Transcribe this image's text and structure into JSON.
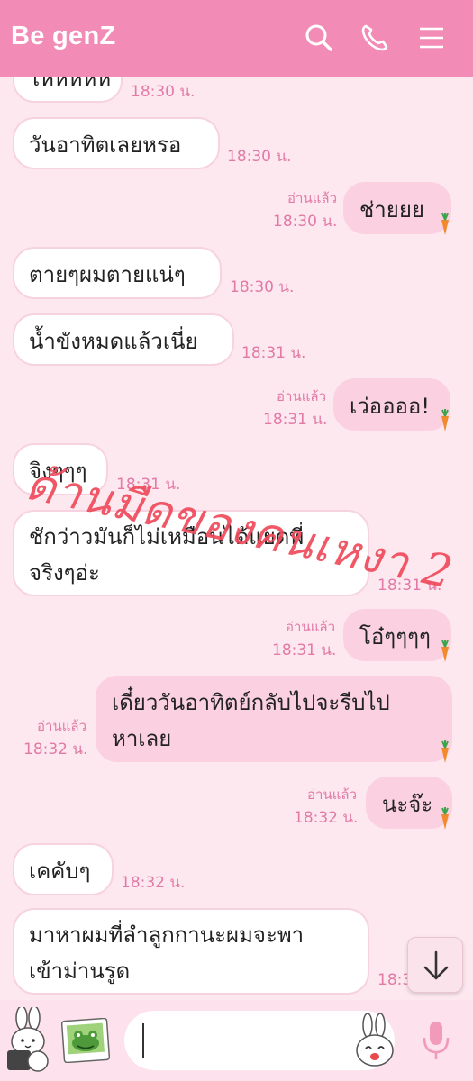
{
  "header": {
    "title": "Be genZ",
    "icons": [
      "search-icon",
      "phone-icon",
      "menu-icon"
    ]
  },
  "messages": [
    {
      "side": "in",
      "text": "ไหหหหห",
      "time": "18:30 น."
    },
    {
      "side": "in",
      "text": "วันอาทิตเลยหรอ",
      "time": "18:30 น."
    },
    {
      "side": "out",
      "text": "ช่ายยย",
      "read": "อ่านแล้ว",
      "time": "18:30 น."
    },
    {
      "side": "in",
      "text": "ตายๆผมตายแน่ๆ",
      "time": "18:30 น."
    },
    {
      "side": "in",
      "text": "น้ำขังหมดแล้วเนี่ย",
      "time": "18:31 น."
    },
    {
      "side": "out",
      "text": "เว่ออออ!",
      "read": "อ่านแล้ว",
      "time": "18:31 น."
    },
    {
      "side": "in",
      "text": "จิงๆๆๆ",
      "time": "18:31 น."
    },
    {
      "side": "in",
      "lines": [
        "ชักว่าวมันก็ไม่เหมือนได้แยดพี่",
        "จริงๆอ่ะ"
      ],
      "time": "18:31 น."
    },
    {
      "side": "out",
      "text": "โอ๋ๆๆๆๆ",
      "read": "อ่านแล้ว",
      "time": "18:31 น."
    },
    {
      "side": "out",
      "lines": [
        "เดี๋ยววันอาทิตย์กลับไปจะรีบไป",
        "หาเลย"
      ],
      "read": "อ่านแล้ว",
      "time": "18:32 น."
    },
    {
      "side": "out",
      "text": "นะจ๊ะ",
      "read": "อ่านแล้ว",
      "time": "18:32 น."
    },
    {
      "side": "in",
      "text": "เคคับๆ",
      "time": "18:32 น."
    },
    {
      "side": "in",
      "lines": [
        "มาหาผมที่ลำลูกกานะผมจะพา",
        "เข้าม่านรูด"
      ],
      "time": "18:3"
    }
  ],
  "watermark": "ด้านมืดของคนเหงา 2",
  "colors": {
    "header": "#f28cb6",
    "background": "#fde8f0",
    "outgoing_bubble": "#fbd1e2",
    "timestamp": "#e27aa5",
    "watermark": "#ef4a5b"
  },
  "composer": {
    "icons": [
      "bunny-sticker-icon",
      "frog-photo-icon",
      "bunny-emoji-icon",
      "microphone-icon"
    ]
  },
  "scroll_button_icon": "arrow-down-icon"
}
